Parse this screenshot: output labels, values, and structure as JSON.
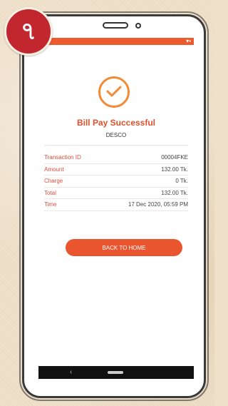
{
  "badge": {
    "text": "৭"
  },
  "screen": {
    "title": "Bill Pay Successful",
    "provider": "DESCO",
    "details": [
      {
        "label": "Transaction ID",
        "value": "00004FKE"
      },
      {
        "label": "Amount",
        "value": "132.00 Tk."
      },
      {
        "label": "Charge",
        "value": "0 Tk."
      },
      {
        "label": "Total",
        "value": "132.00 Tk."
      },
      {
        "label": "Time",
        "value": "17 Dec 2020, 05:59 PM"
      }
    ],
    "button_label": "BACK TO HOME"
  },
  "navbar": {
    "back_icon": "‹"
  },
  "colors": {
    "accent": "#E8552E",
    "success_ring": "#F28A36",
    "status_bar": "#EC5A2D"
  }
}
